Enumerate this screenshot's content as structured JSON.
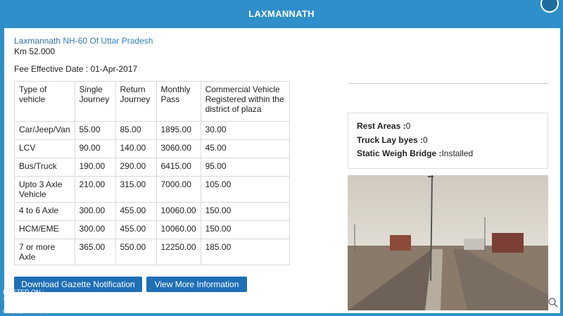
{
  "modal": {
    "title": "LAXMANNATH"
  },
  "plaza": {
    "name": "Laxmannath",
    "highway": "NH-60 Of Uttar Pradesh",
    "km": "Km 52.000",
    "fee_effective": "Fee Effective Date : 01-Apr-2017"
  },
  "table": {
    "headers": [
      "Type of vehicle",
      "Single Journey",
      "Return Journey",
      "Monthly Pass",
      "Commercial Vehicle Registered within the district of plaza"
    ],
    "rows": [
      [
        "Car/Jeep/Van",
        "55.00",
        "85.00",
        "1895.00",
        "30.00"
      ],
      [
        "LCV",
        "90.00",
        "140.00",
        "3060.00",
        "45.00"
      ],
      [
        "Bus/Truck",
        "190.00",
        "290.00",
        "6415.00",
        "95.00"
      ],
      [
        "Upto 3 Axle Vehicle",
        "210.00",
        "315.00",
        "7000.00",
        "105.00"
      ],
      [
        "4 to 6 Axle",
        "300.00",
        "455.00",
        "10060.00",
        "150.00"
      ],
      [
        "HCM/EME",
        "300.00",
        "455.00",
        "10060.00",
        "150.00"
      ],
      [
        "7 or more Axle",
        "365.00",
        "550.00",
        "12250.00",
        "185.00"
      ]
    ]
  },
  "buttons": {
    "download": "Download Gazette Notification",
    "more_info": "View More Information"
  },
  "facilities": {
    "rest_areas_label": "Rest Areas :",
    "rest_areas_value": "0",
    "truck_lay_label": "Truck Lay byes :",
    "truck_lay_value": "0",
    "weigh_label": "Static Weigh Bridge :",
    "weigh_value": "Installed"
  },
  "watermark": {
    "hosted": "HOSTED ON :",
    "logo": "Team-BHP.com",
    "sub": "copyright respective owners"
  },
  "colors": {
    "header": "#2e8fca",
    "button": "#1f6fb5",
    "link_text": "#2f7fb8"
  }
}
